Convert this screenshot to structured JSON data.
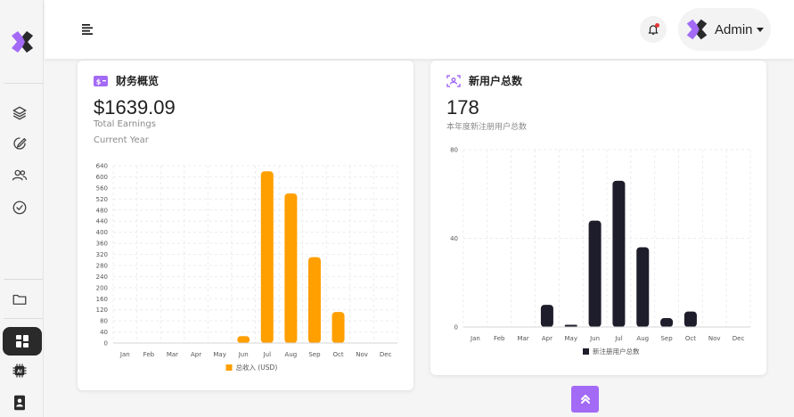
{
  "header": {
    "user_name": "Admin"
  },
  "sidebar": {
    "items": [
      {
        "icon": "layers-icon"
      },
      {
        "icon": "edit-icon"
      },
      {
        "icon": "users-icon"
      },
      {
        "icon": "check-circle-icon"
      },
      {
        "icon": "folder-icon"
      },
      {
        "icon": "dashboard-icon",
        "active": true
      },
      {
        "icon": "ai-chip-icon"
      },
      {
        "icon": "contacts-icon"
      }
    ]
  },
  "colors": {
    "accent": "#a36af5",
    "bar1": "#ff9f00",
    "bar2": "#1e1d2b",
    "active_nav": "#2a2a2a"
  },
  "finance": {
    "title": "财务概览",
    "amount": "$1639.09",
    "label1": "Total Earnings",
    "label2": "Current Year"
  },
  "users": {
    "title": "新用户总数",
    "count": "178",
    "label": "本年度新注册用户总数"
  },
  "chart_data": [
    {
      "type": "bar",
      "categories": [
        "Jan",
        "Feb",
        "Mar",
        "Apr",
        "May",
        "Jun",
        "Jul",
        "Aug",
        "Sep",
        "Oct",
        "Nov",
        "Dec"
      ],
      "series": [
        {
          "name": "总收入 (USD)",
          "values": [
            0,
            0,
            0,
            0,
            0,
            25,
            620,
            540,
            310,
            112,
            0,
            0
          ]
        }
      ],
      "ylim": [
        0,
        640
      ],
      "yticks": [
        0,
        40,
        80,
        120,
        160,
        200,
        240,
        280,
        320,
        360,
        400,
        440,
        480,
        520,
        560,
        600,
        640
      ],
      "grid": true,
      "legend": "bottom"
    },
    {
      "type": "bar",
      "categories": [
        "Jan",
        "Feb",
        "Mar",
        "Apr",
        "May",
        "Jun",
        "Jul",
        "Aug",
        "Sep",
        "Oct",
        "Nov",
        "Dec"
      ],
      "series": [
        {
          "name": "新注册用户总数",
          "values": [
            0,
            0,
            0,
            10,
            1,
            48,
            66,
            36,
            4,
            7,
            0,
            0
          ]
        }
      ],
      "ylim": [
        0,
        80
      ],
      "yticks": [
        0,
        40,
        80
      ],
      "grid": true,
      "legend": "bottom"
    }
  ]
}
